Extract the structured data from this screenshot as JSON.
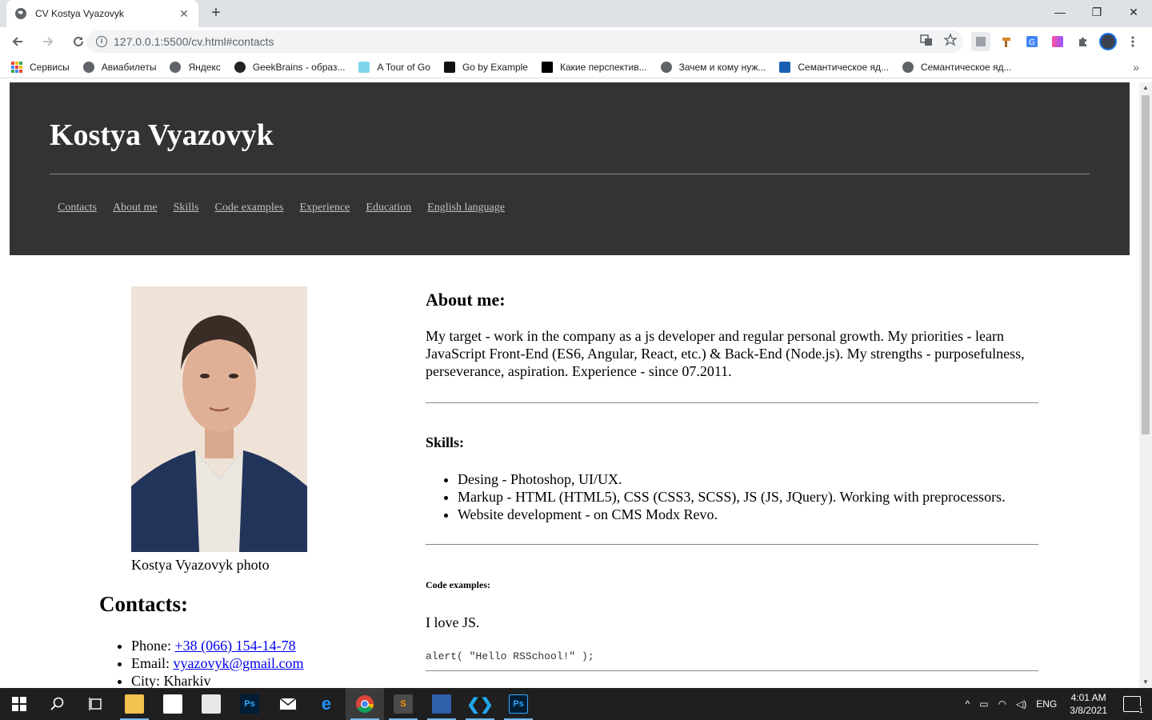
{
  "browser": {
    "tab_title": "CV Kostya Vyazovyk",
    "tab_close": "✕",
    "new_tab": "+",
    "url": "127.0.0.1:5500/cv.html#contacts",
    "window_controls": {
      "minimize": "—",
      "restore": "❐",
      "close": "✕"
    },
    "bookmarks": [
      {
        "label": "Сервисы",
        "icon": "apps-grid-icon"
      },
      {
        "label": "Авиабилеты",
        "icon": "globe-icon"
      },
      {
        "label": "Яндекс",
        "icon": "globe-icon"
      },
      {
        "label": "GeekBrains - образ...",
        "icon": "geekbrains-icon"
      },
      {
        "label": "A Tour of Go",
        "icon": "gopher-icon"
      },
      {
        "label": "Go by Example",
        "icon": "code-icon"
      },
      {
        "label": "Какие перспектив...",
        "icon": "dou-icon"
      },
      {
        "label": "Зачем и кому нуж...",
        "icon": "globe-icon"
      },
      {
        "label": "Семантическое яд...",
        "icon": "semantic-icon"
      },
      {
        "label": "Семантическое яд...",
        "icon": "globe-icon"
      }
    ],
    "bookmarks_more": "»"
  },
  "page": {
    "name": "Kostya Vyazovyk",
    "nav": [
      "Contacts",
      "About me",
      "Skills",
      "Code examples",
      "Experience",
      "Education",
      "English language"
    ],
    "photo_caption": "Kostya Vyazovyk photo",
    "contacts_title": "Contacts:",
    "contacts": {
      "phone_label": "Phone: ",
      "phone": "+38 (066) 154-14-78",
      "email_label": "Email: ",
      "email": "vyazovyk@gmail.com",
      "city_label": "City: ",
      "city": "Kharkiv"
    },
    "about_title": "About me:",
    "about_text": "My target - work in the company as a js developer and regular personal growth. My priorities - learn JavaScript Front-End (ES6, Angular, React, etc.) & Back-End (Node.js). My strengths - purposefulness, perseverance, aspiration. Experience - since 07.2011.",
    "skills_title": "Skills:",
    "skills": [
      "Desing - Photoshop, UI/UX.",
      "Markup - HTML (HTML5), CSS (CSS3, SCSS), JS (JS, JQuery). Working with preprocessors.",
      "Website development - on CMS Modx Revo."
    ],
    "code_title": "Code examples:",
    "code_intro": "I love JS.",
    "code_sample": "alert( \"Hello RSSchool!\" );"
  },
  "taskbar": {
    "language": "ENG",
    "time": "4:01 AM",
    "date": "3/8/2021",
    "notifications": "1"
  },
  "colors": {
    "header_bg": "#333333",
    "tab_strip": "#dee1e6",
    "link": "#0000ee",
    "taskbar": "#1f1f1f"
  }
}
